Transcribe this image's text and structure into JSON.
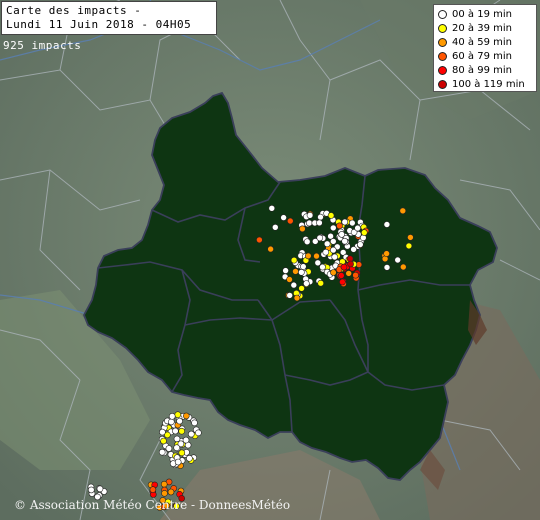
{
  "header": {
    "title_line1": "Carte des impacts -",
    "title_line2": "Lundi 11 Juin 2018 - 04H05"
  },
  "impact_count": "925 impacts",
  "legend": {
    "items": [
      {
        "label": "00 à 19 min",
        "color": "#ffffff"
      },
      {
        "label": "20 à 39 min",
        "color": "#ffff00"
      },
      {
        "label": "40 à 59 min",
        "color": "#ff9900"
      },
      {
        "label": "60 à 79 min",
        "color": "#ff5500"
      },
      {
        "label": "80 à 99 min",
        "color": "#ff0000"
      },
      {
        "label": "100 à 119 min",
        "color": "#cc0000"
      }
    ]
  },
  "copyright": "© Association Météo Centre - DonneesMétéo",
  "colors": {
    "background": "#6c7d6a",
    "region": "#0e3512",
    "border": "#3a3f5a"
  }
}
